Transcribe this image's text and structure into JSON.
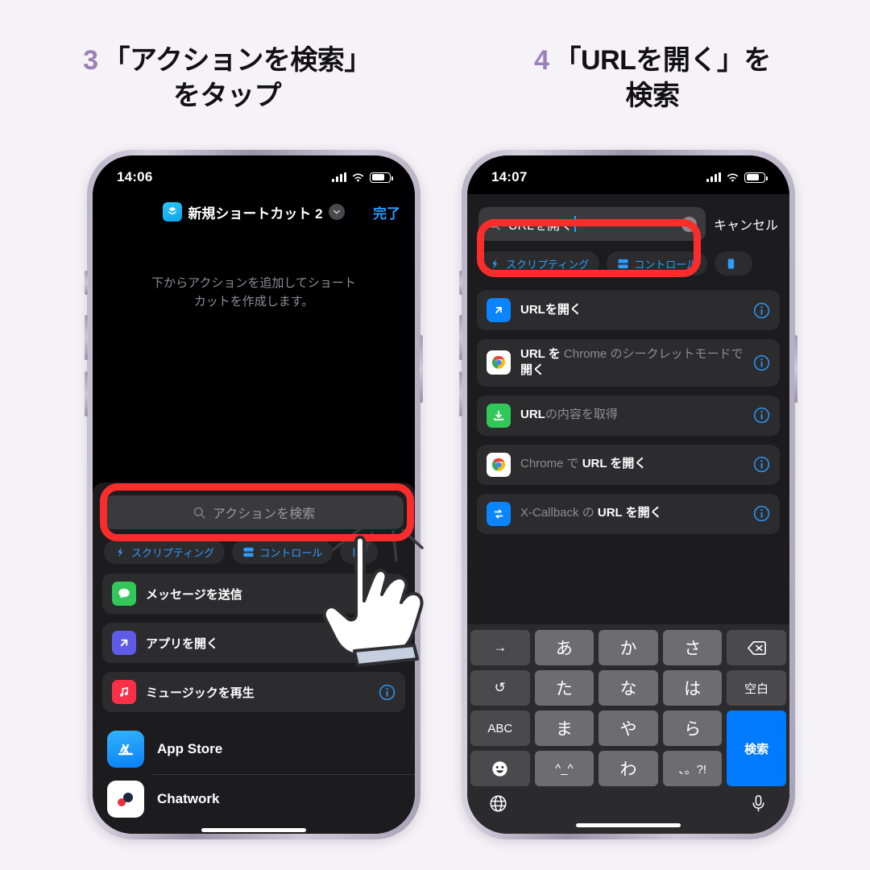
{
  "background_color": "#f5f3f7",
  "accent_color": "#2e9bff",
  "highlight_color": "#fb2c2c",
  "step_number_color": "#9b7fb8",
  "steps": [
    {
      "number": "3",
      "line1": "「アクションを検索」",
      "line2": "をタップ"
    },
    {
      "number": "4",
      "line1": "「URLを開く」を",
      "line2": "検索"
    }
  ],
  "phone_left": {
    "status_bar": {
      "time": "14:06",
      "signal_icon": "cellular-bars-icon",
      "wifi_icon": "wifi-icon",
      "battery_icon": "battery-icon"
    },
    "navbar": {
      "app_icon": "shortcuts-icon",
      "title": "新規ショートカット 2",
      "chevron_icon": "chevron-down-icon",
      "done_label": "完了"
    },
    "empty_state": {
      "line1": "下からアクションを追加してショート",
      "line2": "カットを作成します。"
    },
    "search": {
      "placeholder": "アクションを検索",
      "icon": "search-icon"
    },
    "chips": [
      {
        "label": "スクリプティング",
        "icon": "scripting-icon"
      },
      {
        "label": "コントロール",
        "icon": "control-icon"
      },
      {
        "label": "",
        "icon": "device-icon"
      }
    ],
    "actions": [
      {
        "label": "メッセージを送信",
        "icon": "messages-icon",
        "icon_color": "#32c759",
        "info_icon": "info-icon"
      },
      {
        "label": "アプリを開く",
        "icon": "open-app-icon",
        "icon_color": "#5e5ce6",
        "info_icon": "info-icon"
      },
      {
        "label": "ミュージックを再生",
        "icon": "music-icon",
        "icon_color": "#fa2f48",
        "info_icon": "info-icon"
      }
    ],
    "apps": [
      {
        "label": "App Store",
        "icon": "app-store-icon"
      },
      {
        "label": "Chatwork",
        "icon": "chatwork-icon"
      }
    ]
  },
  "phone_right": {
    "status_bar": {
      "time": "14:07",
      "signal_icon": "cellular-bars-icon",
      "wifi_icon": "wifi-icon",
      "battery_icon": "battery-icon"
    },
    "search": {
      "value": "URLを開く",
      "icon": "search-icon",
      "clear_icon": "clear-icon"
    },
    "cancel_label": "キャンセル",
    "chips": [
      {
        "label": "スクリプティング",
        "icon": "scripting-icon"
      },
      {
        "label": "コントロール",
        "icon": "control-icon"
      },
      {
        "label": "",
        "icon": "device-icon"
      }
    ],
    "results": [
      {
        "parts": [
          {
            "t": "URLを開く",
            "hl": true
          }
        ],
        "icon": "open-url-icon",
        "icon_color": "#0a84ff",
        "info_icon": "info-icon"
      },
      {
        "parts": [
          {
            "t": "URL を ",
            "hl": true
          },
          {
            "t": "Chrome ",
            "hl": false
          },
          {
            "t": "の",
            "hl": false
          },
          {
            "t": "シークレットモード",
            "hl": false
          },
          {
            "t": "で",
            "hl": false
          },
          {
            "t": "開く",
            "hl": true
          }
        ],
        "icon": "chrome-icon",
        "icon_color": "#ffffff",
        "info_icon": "info-icon"
      },
      {
        "parts": [
          {
            "t": "URL",
            "hl": true
          },
          {
            "t": "の内容を",
            "hl": false
          },
          {
            "t": "取得",
            "hl": false
          }
        ],
        "icon": "get-contents-icon",
        "icon_color": "#32c759",
        "info_icon": "info-icon"
      },
      {
        "parts": [
          {
            "t": "Chrome で ",
            "hl": false
          },
          {
            "t": "URL を開く",
            "hl": true
          }
        ],
        "icon": "chrome-icon",
        "icon_color": "#ffffff",
        "info_icon": "info-icon"
      },
      {
        "parts": [
          {
            "t": "X-Callback の ",
            "hl": false
          },
          {
            "t": "URL を開く",
            "hl": true
          }
        ],
        "icon": "x-callback-icon",
        "icon_color": "#0a84ff",
        "info_icon": "info-icon"
      }
    ],
    "keyboard": {
      "rows": [
        [
          {
            "label": "→",
            "type": "fn"
          },
          {
            "label": "あ",
            "type": "key"
          },
          {
            "label": "か",
            "type": "key"
          },
          {
            "label": "さ",
            "type": "key"
          },
          {
            "label": "delete-icon",
            "type": "icon-fn"
          }
        ],
        [
          {
            "label": "↺",
            "type": "fn"
          },
          {
            "label": "た",
            "type": "key"
          },
          {
            "label": "な",
            "type": "key"
          },
          {
            "label": "は",
            "type": "key"
          },
          {
            "label": "空白",
            "type": "fn-small"
          }
        ],
        [
          {
            "label": "ABC",
            "type": "fn-small"
          },
          {
            "label": "ま",
            "type": "key"
          },
          {
            "label": "や",
            "type": "key"
          },
          {
            "label": "ら",
            "type": "key"
          },
          {
            "label": "検索",
            "type": "blue"
          }
        ],
        [
          {
            "label": "emoji-icon",
            "type": "icon-fn"
          },
          {
            "label": "^_^",
            "type": "key-small"
          },
          {
            "label": "わ",
            "type": "key"
          },
          {
            "label": "、。?!",
            "type": "key-small"
          }
        ]
      ],
      "search_key_label": "検索",
      "globe_icon": "globe-icon",
      "mic_icon": "microphone-icon"
    }
  },
  "cursor": {
    "icon": "pointing-hand-cursor"
  }
}
